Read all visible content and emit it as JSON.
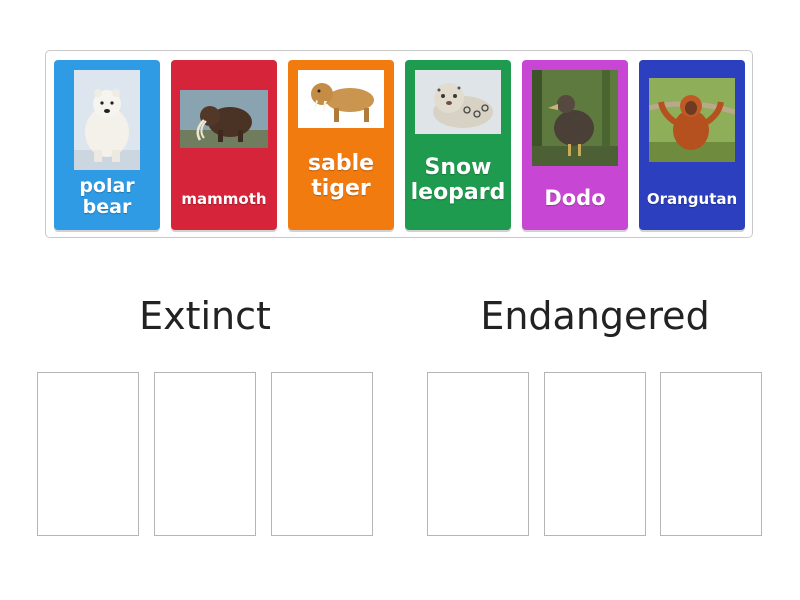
{
  "cards": [
    {
      "label": "polar bear",
      "color": "#2f9be4",
      "image": "polar-bear-photo"
    },
    {
      "label": "mammoth",
      "color": "#d6243a",
      "image": "mammoth-illustration"
    },
    {
      "label": "sable tiger",
      "color": "#f27b10",
      "image": "sabertooth-tiger-illustration"
    },
    {
      "label": "Snow leopard",
      "color": "#1e9b4e",
      "image": "snow-leopard-photo"
    },
    {
      "label": "Dodo",
      "color": "#c746d3",
      "image": "dodo-illustration"
    },
    {
      "label": "Orangutan",
      "color": "#2c3fbf",
      "image": "orangutan-photo"
    }
  ],
  "groups": {
    "extinct": {
      "title": "Extinct"
    },
    "endangered": {
      "title": "Endangered"
    }
  }
}
